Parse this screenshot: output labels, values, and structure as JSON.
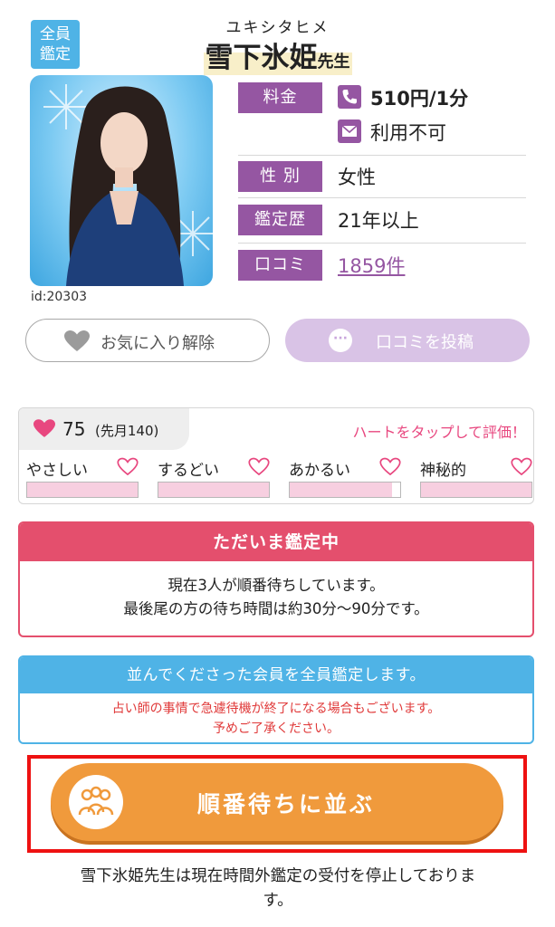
{
  "header": {
    "badge": [
      "全員",
      "鑑定"
    ],
    "name_kana": "ユキシタヒメ",
    "name": "雪下氷姫",
    "name_suffix": "先生",
    "user_id": "id:20303"
  },
  "info": {
    "fee_label": "料金",
    "phone_fee": "510円/1分",
    "mail_fee": "利用不可",
    "gender_label": "性 別",
    "gender": "女性",
    "experience_label": "鑑定歴",
    "experience": "21年以上",
    "reviews_label": "口コミ",
    "reviews_count": "1859件"
  },
  "actions": {
    "favorite_label": "お気に入り解除",
    "review_label": "口コミを投稿"
  },
  "rating": {
    "hearts": "75",
    "last_month": "(先月140)",
    "hint": "ハートをタップして評価！",
    "traits": [
      {
        "label": "やさしい",
        "level": 1.0
      },
      {
        "label": "するどい",
        "level": 1.0
      },
      {
        "label": "あかるい",
        "level": 0.93
      },
      {
        "label": "神秘的",
        "level": 1.0
      }
    ]
  },
  "status": {
    "title": "ただいま鑑定中",
    "line1": "現在3人が順番待ちしています。",
    "line2": "最後尾の方の待ち時間は約30分〜90分です。"
  },
  "notice": {
    "title": "並んでくださった会員を全員鑑定します。",
    "line1": "占い師の事情で急遽待機が終了になる場合もございます。",
    "line2": "予めご了承ください。"
  },
  "queue_button": {
    "label": "順番待ちに並ぶ"
  },
  "footer": {
    "line1": "雪下氷姫先生は現在時間外鑑定の受付を停止しておりま",
    "line2": "す。"
  },
  "colors": {
    "purple": "#9556a2",
    "pink": "#e44f6d",
    "blue": "#4fb3e6",
    "orange": "#f09a3c",
    "highlight_red": "#ee1111"
  },
  "icons": [
    "phone-icon",
    "mail-icon",
    "heart-icon",
    "comment-bubble-icon",
    "people-icon"
  ]
}
